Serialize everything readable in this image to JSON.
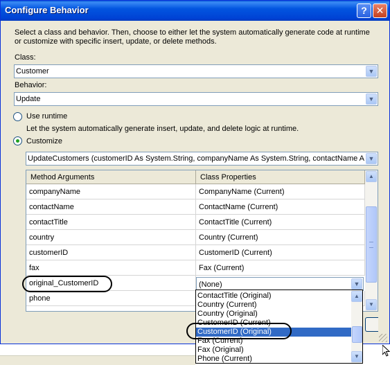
{
  "window": {
    "title": "Configure Behavior",
    "help_glyph": "?",
    "close_glyph": "✕"
  },
  "instructions": "Select a class and behavior.  Then, choose to either let the system automatically generate code at runtime or customize with specific insert, update, or delete methods.",
  "class_field": {
    "label": "Class:",
    "value": "Customer"
  },
  "behavior_field": {
    "label": "Behavior:",
    "value": "Update"
  },
  "options": {
    "use_runtime": {
      "label": "Use runtime",
      "description": "Let the system automatically generate insert, update, and delete logic at runtime.",
      "selected": false
    },
    "customize": {
      "label": "Customize",
      "selected": true
    }
  },
  "method_combo": {
    "value": "UpdateCustomers (customerID As System.String, companyName As System.String, contactName As System.String, contactTitle As System.String)"
  },
  "grid": {
    "columns": [
      "Method Arguments",
      "Class Properties"
    ],
    "rows": [
      {
        "argument": "companyName",
        "property": "CompanyName (Current)"
      },
      {
        "argument": "contactName",
        "property": "ContactName (Current)"
      },
      {
        "argument": "contactTitle",
        "property": "ContactTitle (Current)"
      },
      {
        "argument": "country",
        "property": "Country (Current)"
      },
      {
        "argument": "customerID",
        "property": "CustomerID (Current)"
      },
      {
        "argument": "fax",
        "property": "Fax (Current)"
      },
      {
        "argument": "original_CustomerID",
        "property": "(None)"
      },
      {
        "argument": "phone",
        "property": ""
      }
    ]
  },
  "dropdown": {
    "items": [
      "ContactTitle (Original)",
      "Country (Current)",
      "Country (Original)",
      "CustomerID (Current)",
      "CustomerID (Original)",
      "Fax (Current)",
      "Fax (Original)",
      "Phone (Current)"
    ],
    "selected": "CustomerID (Original)"
  },
  "icons": {
    "dropdown_arrow": "chevron-down-icon",
    "scroll_up": "chevron-up-icon",
    "scroll_down": "chevron-down-icon"
  }
}
